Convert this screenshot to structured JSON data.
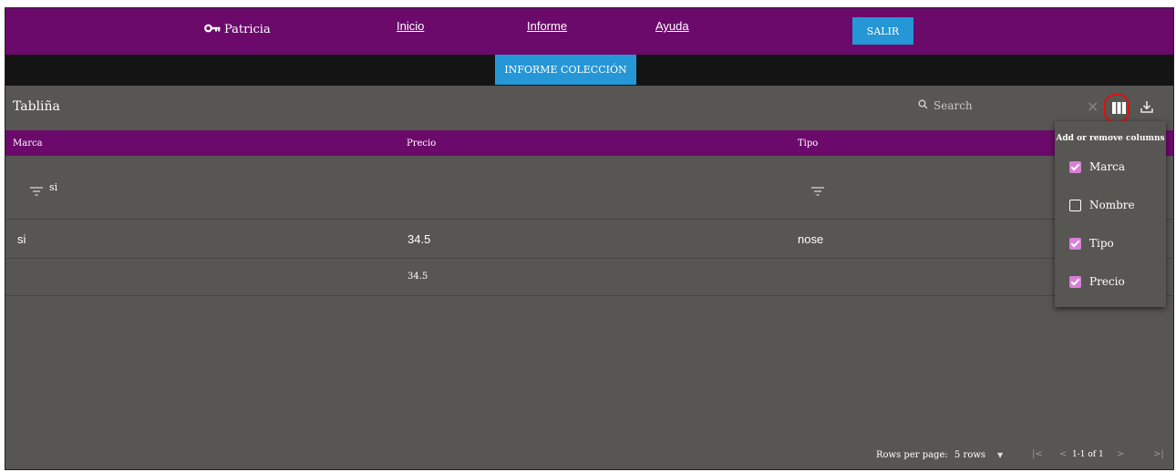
{
  "nav": {
    "user": "Patricia",
    "links": [
      "Inicio",
      "Informe",
      "Ayuda"
    ],
    "logout": "SALIR"
  },
  "report_button": "INFORME COLECCIÓN",
  "table": {
    "title": "Tabliña",
    "search_placeholder": "Search",
    "columns": [
      "Marca",
      "Precio",
      "Tipo"
    ],
    "filter_value": "si",
    "rows": [
      {
        "marca": "si",
        "precio": "34.5",
        "tipo": "nose"
      },
      {
        "marca": "",
        "precio": "34.5",
        "tipo": ""
      }
    ]
  },
  "column_picker": {
    "title": "Add or remove columns",
    "options": [
      {
        "label": "Marca",
        "checked": true
      },
      {
        "label": "Nombre",
        "checked": false
      },
      {
        "label": "Tipo",
        "checked": true
      },
      {
        "label": "Precio",
        "checked": true
      }
    ]
  },
  "pagination": {
    "rows_per_page_label": "Rows per page:",
    "rows_per_page_value": "5 rows",
    "range": "1-1 of 1"
  },
  "colors": {
    "nav_bg": "#6b0a6b",
    "button_blue": "#2596d6",
    "table_bg": "#575653",
    "checkbox": "#d87fd8",
    "highlight": "#e01010"
  }
}
